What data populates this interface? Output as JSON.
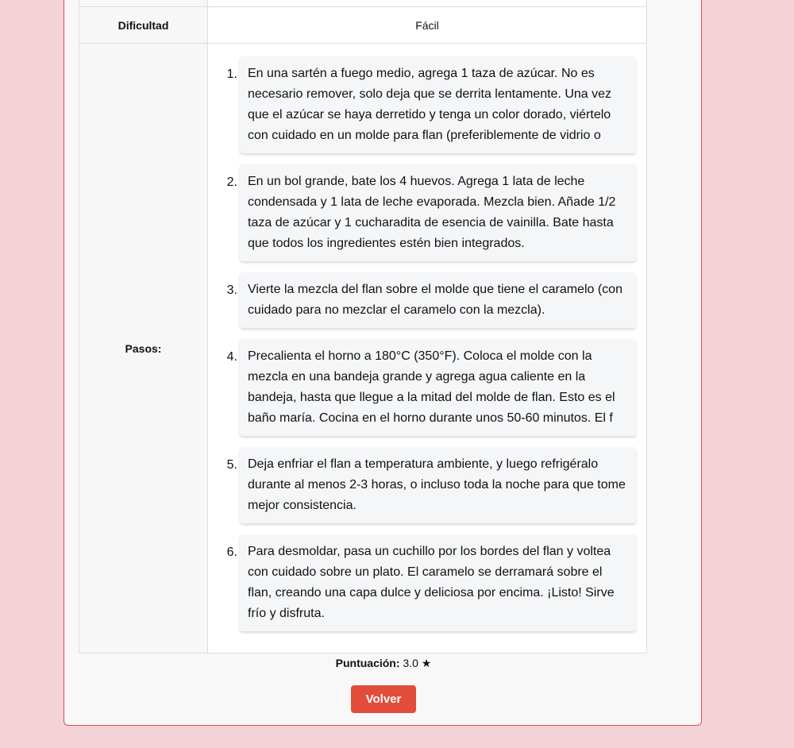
{
  "details": {
    "difficulty_label": "Dificultad",
    "difficulty_value": "Fácil",
    "steps_label": "Pasos:",
    "steps": [
      {
        "number": "1.",
        "text": "En una sartén a fuego medio, agrega 1 taza de azúcar. No es necesario remover, solo deja que se derrita lentamente. Una vez que el azúcar se haya derretido y tenga un color dorado, viértelo con cuidado en un molde para flan (preferiblemente de vidrio o"
      },
      {
        "number": "2.",
        "text": "En un bol grande, bate los 4 huevos. Agrega 1 lata de leche condensada y 1 lata de leche evaporada. Mezcla bien. Añade 1/2 taza de azúcar y 1 cucharadita de esencia de vainilla. Bate hasta que todos los ingredientes estén bien integrados."
      },
      {
        "number": "3.",
        "text": "Vierte la mezcla del flan sobre el molde que tiene el caramelo (con cuidado para no mezclar el caramelo con la mezcla)."
      },
      {
        "number": "4.",
        "text": "Precalienta el horno a 180°C (350°F). Coloca el molde con la mezcla en una bandeja grande y agrega agua caliente en la bandeja, hasta que llegue a la mitad del molde de flan. Esto es el baño maría. Cocina en el horno durante unos 50-60 minutos. El f"
      },
      {
        "number": "5.",
        "text": "Deja enfriar el flan a temperatura ambiente, y luego refrigéralo durante al menos 2-3 horas, o incluso toda la noche para que tome mejor consistencia."
      },
      {
        "number": "6.",
        "text": "Para desmoldar, pasa un cuchillo por los bordes del flan y voltea con cuidado sobre un plato. El caramelo se derramará sobre el flan, creando una capa dulce y deliciosa por encima. ¡Listo! Sirve frío y disfruta."
      }
    ]
  },
  "rating": {
    "label": "Puntuación:",
    "value": "3.0",
    "star": "★"
  },
  "actions": {
    "back_label": "Volver"
  },
  "colors": {
    "background": "#f3d3d5",
    "card_border": "#d9534f",
    "button": "#e14d3a"
  }
}
